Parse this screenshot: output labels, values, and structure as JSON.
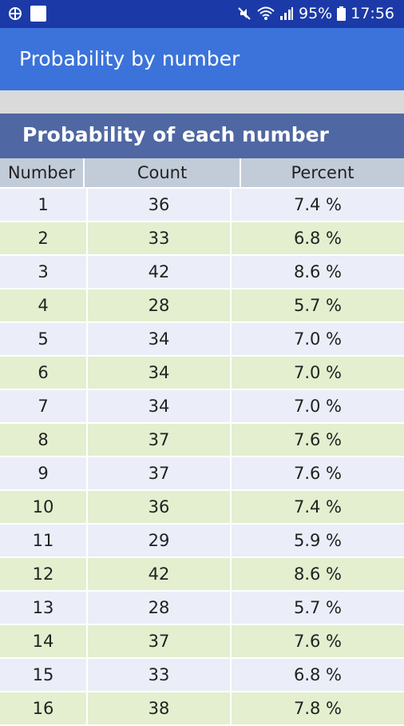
{
  "status_bar": {
    "battery": "95%",
    "time": "17:56",
    "icons": [
      "vpn-icon",
      "notification-square-icon",
      "mute-icon",
      "wifi-icon",
      "signal-icon",
      "battery-icon"
    ]
  },
  "app_bar": {
    "title": "Probability by number"
  },
  "section": {
    "title": "Probability of each number"
  },
  "table": {
    "headers": [
      "Number",
      "Count",
      "Percent"
    ],
    "rows": [
      {
        "number": "1",
        "count": "36",
        "percent": "7.4 %"
      },
      {
        "number": "2",
        "count": "33",
        "percent": "6.8 %"
      },
      {
        "number": "3",
        "count": "42",
        "percent": "8.6 %"
      },
      {
        "number": "4",
        "count": "28",
        "percent": "5.7 %"
      },
      {
        "number": "5",
        "count": "34",
        "percent": "7.0 %"
      },
      {
        "number": "6",
        "count": "34",
        "percent": "7.0 %"
      },
      {
        "number": "7",
        "count": "34",
        "percent": "7.0 %"
      },
      {
        "number": "8",
        "count": "37",
        "percent": "7.6 %"
      },
      {
        "number": "9",
        "count": "37",
        "percent": "7.6 %"
      },
      {
        "number": "10",
        "count": "36",
        "percent": "7.4 %"
      },
      {
        "number": "11",
        "count": "29",
        "percent": "5.9 %"
      },
      {
        "number": "12",
        "count": "42",
        "percent": "8.6 %"
      },
      {
        "number": "13",
        "count": "28",
        "percent": "5.7 %"
      },
      {
        "number": "14",
        "count": "37",
        "percent": "7.6 %"
      },
      {
        "number": "15",
        "count": "33",
        "percent": "6.8 %"
      },
      {
        "number": "16",
        "count": "38",
        "percent": "7.8 %"
      }
    ]
  },
  "colors": {
    "status_bar": "#1b3aa8",
    "app_bar": "#3b73da",
    "section_header": "#4f67a2",
    "table_header": "#c2ccd9",
    "row_odd": "#ebeef8",
    "row_even": "#e3efcf"
  }
}
